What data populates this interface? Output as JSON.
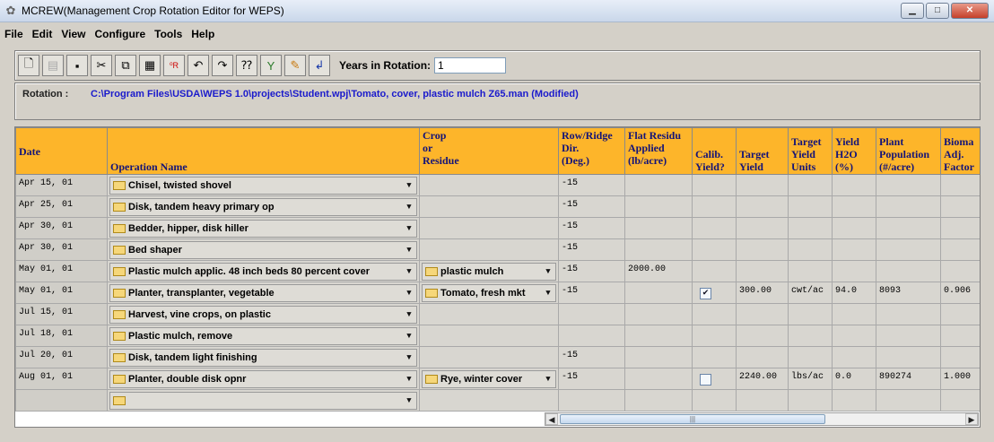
{
  "window": {
    "title": "MCREW(Management Crop Rotation Editor for WEPS)",
    "buttons": {
      "minimize": "▁",
      "maximize": "□",
      "close": "✕"
    }
  },
  "menu": [
    "File",
    "Edit",
    "View",
    "Configure",
    "Tools",
    "Help"
  ],
  "toolbar": {
    "icons": [
      "new-file-icon",
      "open-icon",
      "save-icon",
      "cut-icon",
      "copy-icon",
      "paste-icon",
      "sort-icon",
      "undo-icon",
      "redo-icon",
      "help-pointer-icon",
      "filter-icon",
      "edit-icon",
      "check-icon"
    ],
    "years_label": "Years in Rotation:",
    "years_value": "1"
  },
  "rotation": {
    "label": "Rotation :",
    "path": "C:\\Program Files\\USDA\\WEPS 1.0\\projects\\Student.wpj\\Tomato, cover, plastic mulch Z65.man  (Modified)"
  },
  "grid": {
    "headers": [
      "Date",
      "Operation Name",
      "Crop\nor\nResidue",
      "Row/Ridge\nDir.\n(Deg.)",
      "Flat Residu\nApplied\n(lb/acre)",
      "Calib.\nYield?",
      "Target\nYield",
      "Target\nYield\nUnits",
      "Yield\nH2O\n(%)",
      "Plant\nPopulation\n(#/acre)",
      "Bioma\nAdj.\nFactor"
    ],
    "rows": [
      {
        "date": "Apr 15, 01",
        "op": "Chisel, twisted shovel",
        "crop": "",
        "dir": "-15",
        "flat": "",
        "calib": "",
        "yield": "",
        "units": "",
        "h2o": "",
        "pop": "",
        "bio": ""
      },
      {
        "date": "Apr 25, 01",
        "op": "Disk, tandem heavy primary op",
        "crop": "",
        "dir": "-15",
        "flat": "",
        "calib": "",
        "yield": "",
        "units": "",
        "h2o": "",
        "pop": "",
        "bio": ""
      },
      {
        "date": "Apr 30, 01",
        "op": "Bedder, hipper, disk hiller",
        "crop": "",
        "dir": "-15",
        "flat": "",
        "calib": "",
        "yield": "",
        "units": "",
        "h2o": "",
        "pop": "",
        "bio": ""
      },
      {
        "date": "Apr 30, 01",
        "op": "Bed shaper",
        "crop": "",
        "dir": "-15",
        "flat": "",
        "calib": "",
        "yield": "",
        "units": "",
        "h2o": "",
        "pop": "",
        "bio": ""
      },
      {
        "date": "May 01, 01",
        "op": "Plastic mulch applic. 48 inch beds 80 percent cover",
        "crop": "plastic mulch",
        "dir": "-15",
        "flat": "2000.00",
        "calib": "",
        "yield": "",
        "units": "",
        "h2o": "",
        "pop": "",
        "bio": ""
      },
      {
        "date": "May 01, 01",
        "op": "Planter, transplanter, vegetable",
        "crop": "Tomato, fresh mkt",
        "dir": "-15",
        "flat": "",
        "calib": "checked",
        "yield": "300.00",
        "units": "cwt/ac",
        "h2o": "94.0",
        "pop": "8093",
        "bio": "0.906"
      },
      {
        "date": "Jul 15, 01",
        "op": "Harvest, vine crops, on plastic",
        "crop": "",
        "dir": "",
        "flat": "",
        "calib": "",
        "yield": "",
        "units": "",
        "h2o": "",
        "pop": "",
        "bio": ""
      },
      {
        "date": "Jul 18, 01",
        "op": "Plastic mulch, remove",
        "crop": "",
        "dir": "",
        "flat": "",
        "calib": "",
        "yield": "",
        "units": "",
        "h2o": "",
        "pop": "",
        "bio": ""
      },
      {
        "date": "Jul 20, 01",
        "op": "Disk, tandem light finishing",
        "crop": "",
        "dir": "-15",
        "flat": "",
        "calib": "",
        "yield": "",
        "units": "",
        "h2o": "",
        "pop": "",
        "bio": ""
      },
      {
        "date": "Aug 01, 01",
        "op": "Planter, double disk opnr",
        "crop": "Rye, winter cover",
        "dir": "-15",
        "flat": "",
        "calib": "unchecked",
        "yield": "2240.00",
        "units": "lbs/ac",
        "h2o": "0.0",
        "pop": "890274",
        "bio": "1.000"
      },
      {
        "date": "",
        "op": "",
        "crop": "",
        "dir": "",
        "flat": "",
        "calib": "",
        "yield": "",
        "units": "",
        "h2o": "",
        "pop": "",
        "bio": ""
      }
    ]
  },
  "scrollbar": {
    "left_arrow": "◀",
    "right_arrow": "▶",
    "grip": "|||"
  },
  "colors": {
    "header_bg": "#fdb52a",
    "header_text": "#141478",
    "rotation_path": "#1a1acc"
  }
}
